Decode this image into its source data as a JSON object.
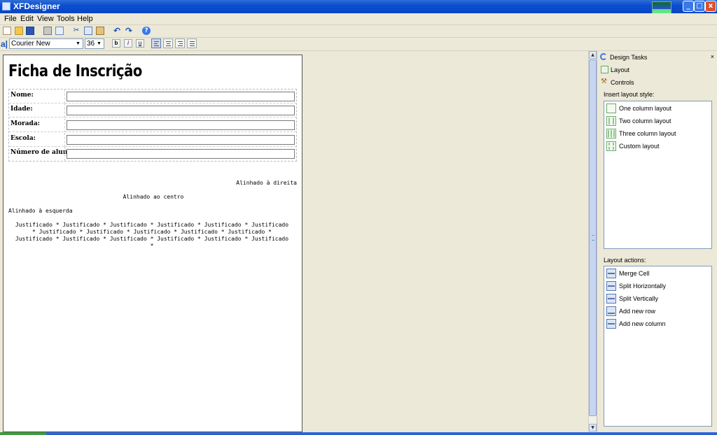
{
  "window": {
    "title": "XFDesigner"
  },
  "menu": {
    "items": [
      "File",
      "Edit",
      "View",
      "Tools",
      "Help"
    ]
  },
  "format_toolbar": {
    "font_family": "Courier New",
    "font_size": "36",
    "bold": "b",
    "italic": "i",
    "underline": "u",
    "active_alignment": "left"
  },
  "document": {
    "title": "Ficha de Inscrição",
    "form_fields": [
      {
        "label": "Nome:",
        "value": ""
      },
      {
        "label": "Idade:",
        "value": ""
      },
      {
        "label": "Morada:",
        "value": ""
      },
      {
        "label": "Escola:",
        "value": ""
      },
      {
        "label": "Número de aluno:",
        "value": ""
      }
    ],
    "align_right_text": "Alinhado à direita",
    "align_center_text": "Alinhado ao centro",
    "align_left_text": "Alinhado à esquerda",
    "justified_lines": [
      "Justificado * Justificado * Justificado * Justificado * Justificado * Justificado",
      "* Justificado * Justificado * Justificado * Justificado * Justificado *",
      "Justificado * Justificado * Justificado * Justificado * Justificado * Justificado",
      "*"
    ]
  },
  "panel": {
    "title": "Design Tasks",
    "close": "×",
    "links": [
      "Layout",
      "Controls"
    ],
    "insert_layout_label": "Insert layout style:",
    "layout_styles": [
      "One column layout",
      "Two column layout",
      "Three column layout",
      "Custom layout"
    ],
    "layout_actions_label": "Layout actions:",
    "layout_actions": [
      "Merge Cell",
      "Split Horizontally",
      "Split Vertically",
      "Add new row",
      "Add new column"
    ]
  },
  "colors": {
    "titlebar": "#0a4fd0",
    "panel_bg": "#ece9d8",
    "link_blue": "#3a78e8"
  },
  "icons": {
    "toolbar": [
      "new-document-icon",
      "open-folder-icon",
      "save-icon",
      "print-icon",
      "print-preview-icon",
      "cut-icon",
      "copy-icon",
      "paste-icon",
      "undo-icon",
      "redo-icon",
      "help-icon"
    ]
  }
}
